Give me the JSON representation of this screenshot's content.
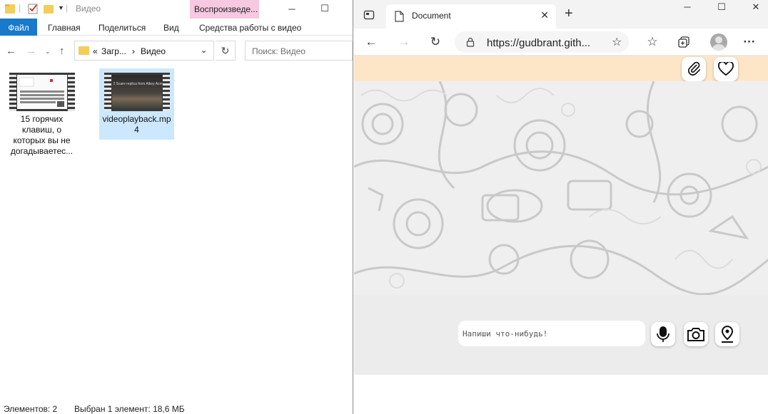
{
  "explorer": {
    "title": "Видео",
    "contextual_tab": "Воспроизведе...",
    "ribbon_tabs": [
      "Файл",
      "Главная",
      "Поделиться",
      "Вид",
      "Средства работы с видео"
    ],
    "address": {
      "overflow": "«",
      "crumb_1": "Загр...",
      "separator": "›",
      "crumb_2": "Видео"
    },
    "search_placeholder": "Поиск: Видео",
    "files": [
      {
        "name": "15 горячих клавиш, о которых вы не догадываетес...",
        "selected": false
      },
      {
        "name": "videoplayback.mp4",
        "selected": true,
        "thumb_caption": "2 Scare replica from Alkey Acm"
      }
    ],
    "status": {
      "count": "Элементов: 2",
      "selection": "Выбран 1 элемент: 18,6 МБ"
    },
    "colors": {
      "file_tab": "#1979ca",
      "context_tab": "#f7c8e2",
      "selection": "#cce8ff",
      "folder": "#f4cd5a"
    }
  },
  "edge": {
    "tab_title": "Document",
    "url": "https://gudbrant.gith...",
    "icons": [
      "tab-actions-icon",
      "back-icon",
      "forward-icon",
      "refresh-icon",
      "lock-icon",
      "add-favorite-icon",
      "favorites-icon",
      "collections-icon",
      "profile-icon",
      "more-icon",
      "close-icon",
      "new-tab-icon"
    ]
  },
  "page": {
    "message_placeholder": "Напиши что-нибудь!",
    "buttons": [
      "paperclip-icon",
      "heart-icon",
      "microphone-icon",
      "camera-icon",
      "location-pin-icon"
    ],
    "colors": {
      "top_bar": "#fde6c8",
      "background": "#efefef"
    }
  }
}
